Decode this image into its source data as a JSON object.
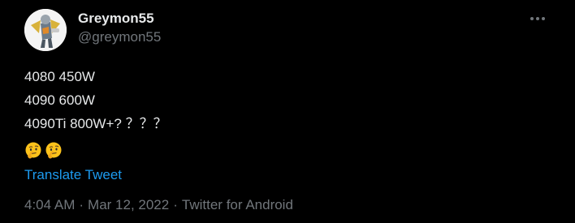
{
  "author": {
    "display_name": "Greymon55",
    "handle": "@greymon55",
    "avatar_icon": "digimon-avatar"
  },
  "menu": {
    "more_icon": "more-horizontal-icon"
  },
  "tweet": {
    "lines": [
      "4080 450W",
      "4090 600W",
      "4090Ti 800W+? ？？？"
    ],
    "emojis": [
      "thinking-face-emoji",
      "thinking-face-emoji"
    ],
    "translate_label": "Translate Tweet"
  },
  "meta": {
    "time": "4:04 AM",
    "separator": "·",
    "date": "Mar 12, 2022",
    "source": "Twitter for Android"
  },
  "colors": {
    "background": "#000000",
    "text_primary": "#e7e9ea",
    "text_secondary": "#71767b",
    "link": "#1d9bf0"
  }
}
